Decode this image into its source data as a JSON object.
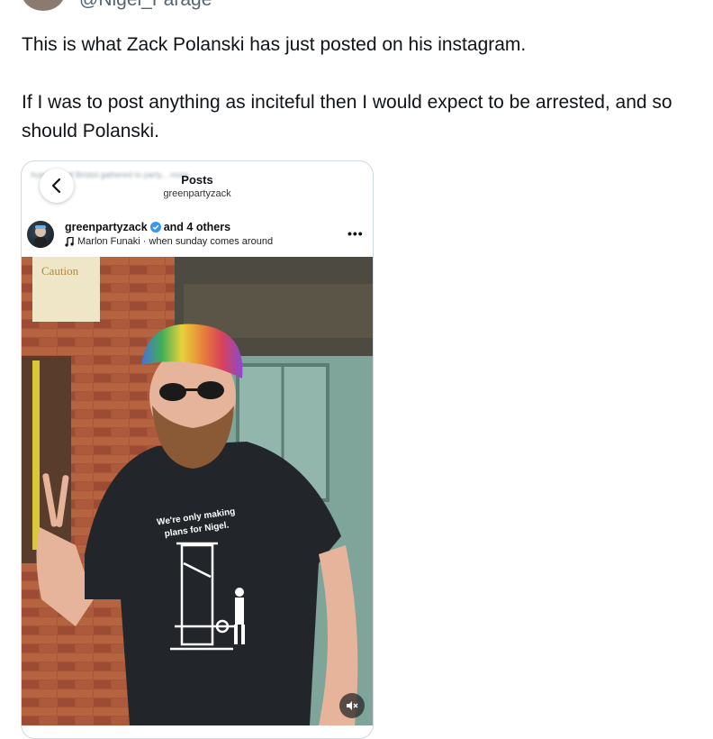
{
  "tweet": {
    "handle": "@Nigel_Farage",
    "paragraph1": "This is what Zack Polanski has just posted on his instagram.",
    "paragraph2": "If I was to post anything as inciteful then I would expect to be arrested, and so should Polanski."
  },
  "instagram": {
    "header_title": "Posts",
    "header_subtitle": "greenpartyzack",
    "blurred_caption": "hundreds of Bristol gathered to party... more",
    "username": "greenpartyzack",
    "coauthors": "and 4 others",
    "music": "Marlon Funaki · when sunday comes around",
    "shirt_line1": "We're only making",
    "shirt_line2": "plans for Nigel.",
    "sign_text": "Caution"
  },
  "colors": {
    "brick": "#a8553a",
    "teal": "#7fa49a",
    "shirt": "#22262b",
    "verified": "#3897f0"
  }
}
